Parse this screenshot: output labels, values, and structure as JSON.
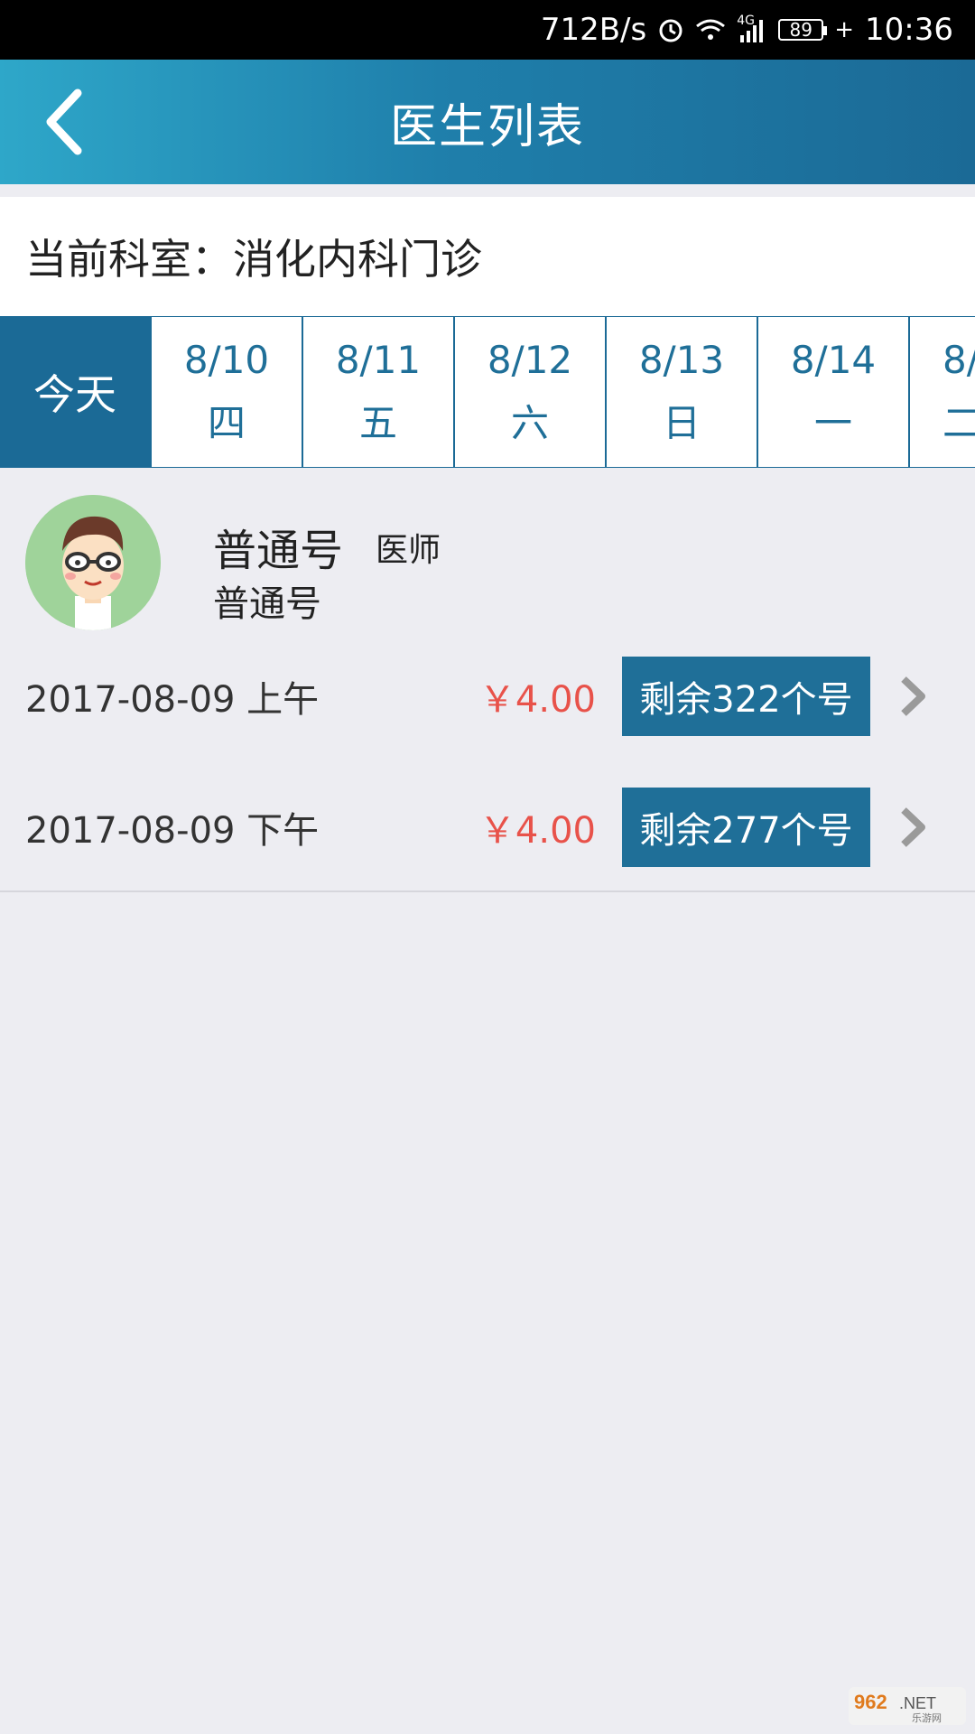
{
  "status_bar": {
    "speed": "712B/s",
    "network": "4G",
    "battery": "89",
    "time": "10:36"
  },
  "nav": {
    "title": "医生列表"
  },
  "department": {
    "text": "当前科室：消化内科门诊"
  },
  "dates": {
    "today_label": "今天",
    "items": [
      {
        "date": "8/10",
        "weekday": "四"
      },
      {
        "date": "8/11",
        "weekday": "五"
      },
      {
        "date": "8/12",
        "weekday": "六"
      },
      {
        "date": "8/13",
        "weekday": "日"
      },
      {
        "date": "8/14",
        "weekday": "一"
      },
      {
        "date": "8/",
        "weekday": "二"
      }
    ]
  },
  "doctor": {
    "name": "普通号",
    "title": "医师",
    "subtitle": "普通号",
    "slots": [
      {
        "time": "2017-08-09 上午",
        "price": "￥4.00",
        "remaining": "剩余322个号"
      },
      {
        "time": "2017-08-09 下午",
        "price": "￥4.00",
        "remaining": "剩余277个号"
      }
    ]
  },
  "watermark": {
    "text": "962.NET 乐游网"
  },
  "colors": {
    "primary": "#1f6f98",
    "price": "#e8524a",
    "background": "#ededf2"
  }
}
